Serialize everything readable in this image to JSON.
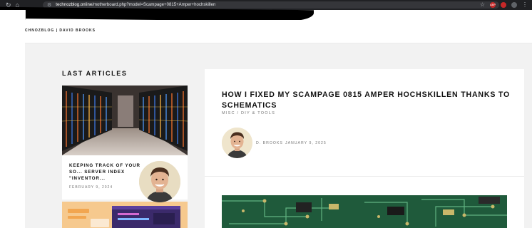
{
  "browser": {
    "url_domain": "technozblog.online",
    "url_path": "/motherboard.php?model=Scampage+0815+Amper+hochskillen",
    "extension_label": "ABP"
  },
  "site": {
    "brand": "CHNOZBLOG | DAVID BROOKS"
  },
  "sidebar": {
    "heading": "LAST ARTICLES",
    "articles": [
      {
        "title": "KEEPING TRACK OF YOUR SO... SERVER INDEX \"INVENTOR...",
        "date": "FEBRUARY 9, 2024"
      }
    ]
  },
  "article": {
    "title": "HOW I FIXED MY SCAMPAGE 0815 AMPER HOCHSKILLEN THANKS TO SCHEMATICS",
    "categories": "MISC / DIY & TOOLS",
    "author": "D. BROOKS",
    "date": "JANUARY 9, 2025"
  }
}
